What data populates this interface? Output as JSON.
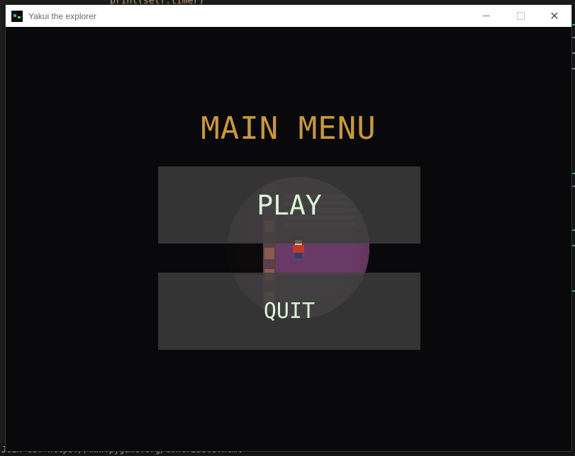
{
  "background_editor": {
    "top_code": "print(self.timer)",
    "bottom_line": "Join us: https://www.pygame.org/contribute.html"
  },
  "window": {
    "title": "Yakui the explorer",
    "icon": "pygame-window-icon",
    "controls": [
      "minimize",
      "maximize",
      "close"
    ]
  },
  "menu": {
    "title": "MAIN MENU",
    "play_label": "PLAY",
    "quit_label": "QUIT"
  },
  "colors": {
    "title": "#c9973f",
    "button_text": "#d8f5d3",
    "button_bg": "#404040",
    "game_bg": "#09090b"
  }
}
